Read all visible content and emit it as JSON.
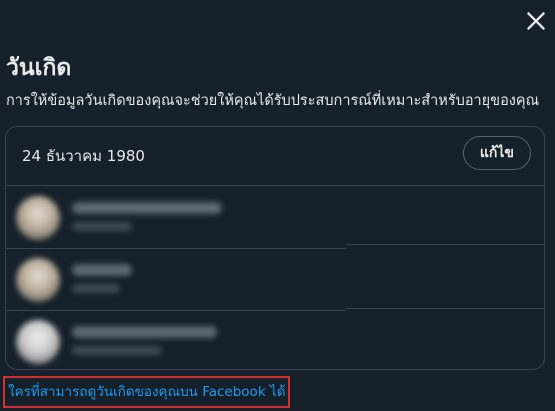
{
  "dialog": {
    "title": "วันเกิด",
    "subtitle": "การให้ข้อมูลวันเกิดของคุณจะช่วยให้คุณได้รับประสบการณ์ที่เหมาะสำหรับอายุของคุณ",
    "close_icon": "close-icon"
  },
  "birthday": {
    "value": "24 ธันวาคม 1980",
    "edit_label": "แก้ไข"
  },
  "footer": {
    "link_text": "ใครที่สามารถดูวันเกิดของคุณบน Facebook ได้",
    "link_color": "#1d9bf0",
    "highlight_color": "#d32f2f"
  },
  "colors": {
    "background": "#15202b",
    "border": "#38444d",
    "text": "#e7e9ea"
  }
}
